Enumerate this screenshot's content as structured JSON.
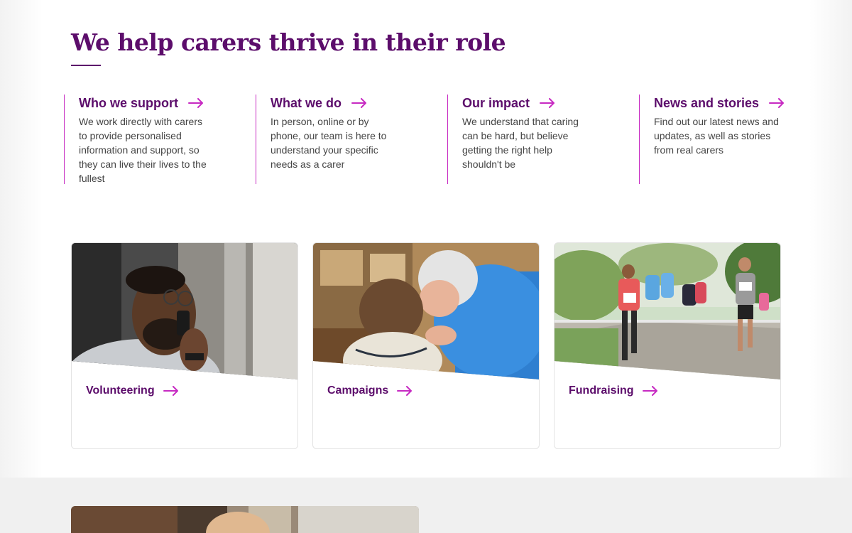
{
  "section": {
    "heading": "We help carers thrive in their role"
  },
  "links": [
    {
      "title": "Who we support",
      "description": "We work directly with carers to provide personalised information and support, so they can live their lives to the fullest"
    },
    {
      "title": "What we do",
      "description": "In person, online or by phone, our team is here to understand your specific needs as a carer"
    },
    {
      "title": "Our impact",
      "description": "We understand that caring can be hard, but believe getting the right help shouldn't be"
    },
    {
      "title": "News and stories",
      "description": "Find out our latest news and updates, as well as stories from real carers"
    }
  ],
  "cards": [
    {
      "label": "Volunteering",
      "image": "man-on-phone-photo"
    },
    {
      "label": "Campaigns",
      "image": "elderly-man-and-child-photo"
    },
    {
      "label": "Fundraising",
      "image": "runners-race-photo"
    }
  ],
  "icons": {
    "link_arrow": "arrow-right-icon"
  },
  "colors": {
    "brand_purple": "#5c0d6b",
    "accent_magenta": "#c72ac2",
    "body_text": "#444444"
  }
}
